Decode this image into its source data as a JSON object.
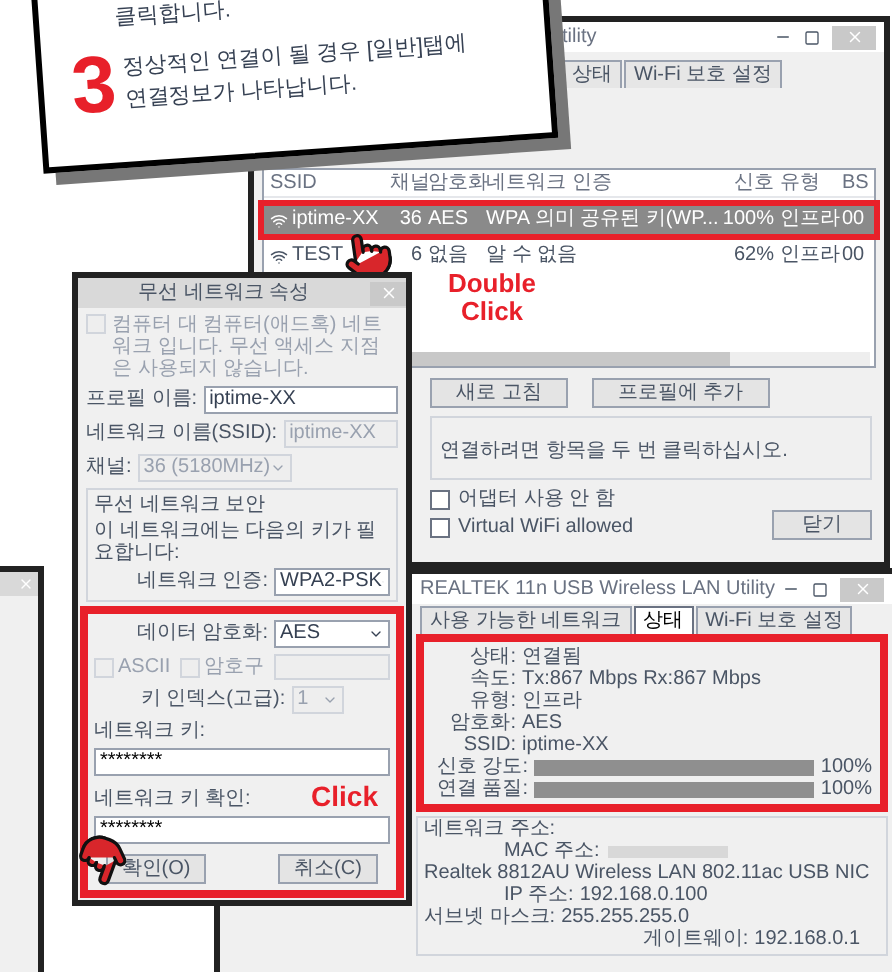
{
  "callout": {
    "previous_line": "클릭합니다.",
    "step_number": "3",
    "text": "정상적인 연결이 될 경우 [일반]탭에 연결정보가 나타납니다."
  },
  "networks_window": {
    "title": "tility",
    "tabs": [
      {
        "label": "상태",
        "selected": false
      },
      {
        "label": "Wi-Fi 보호 설정",
        "selected": false
      }
    ],
    "columns": [
      "SSID",
      "채널",
      "암호화",
      "네트워크 인증",
      "신호",
      "유형",
      "BS"
    ],
    "rows": [
      {
        "ssid": "iptime-XX",
        "channel": "36",
        "encryption": "AES",
        "auth": "WPA 의미 공유된 키(WP...",
        "signal": "100%",
        "type": "인프라",
        "bssid": "00",
        "selected": true
      },
      {
        "ssid": "TEST",
        "channel": "6",
        "encryption": "없음",
        "auth": "알 수 없음",
        "signal": "62%",
        "type": "인프라",
        "bssid": "00",
        "selected": false
      }
    ],
    "gesture_label": "Double Click",
    "buttons": [
      "새로 고침",
      "프로필에 추가"
    ],
    "hint": "연결하려면 항목을 두 번 클릭하십시오.",
    "options": [
      {
        "label": "어댑터 사용 안 함",
        "checked": false
      },
      {
        "label": "Virtual WiFi allowed",
        "checked": false
      }
    ],
    "close_button": "닫기"
  },
  "properties_dialog": {
    "title": "무선 네트워크 속성",
    "adhoc": {
      "label": "컴퓨터 대 컴퓨터(애드혹) 네트워크 입니다. 무선 액세스 지점은 사용되지 않습니다.",
      "checked": false,
      "disabled": true
    },
    "fields": [
      {
        "kind": "input",
        "label": "프로필 이름:",
        "value": "iptime-XX",
        "disabled": false
      },
      {
        "kind": "input",
        "label": "네트워크 이름(SSID):",
        "value": "iptime-XX",
        "disabled": true
      },
      {
        "kind": "select",
        "label": "채널:",
        "value": "36 (5180MHz)",
        "disabled": true
      }
    ],
    "security_group": "무선 네트워크 보안",
    "security_note": "이 네트워크에는 다음의 키가 필요합니다:",
    "auth": {
      "label": "네트워크 인증:",
      "value": "WPA2-PSK"
    },
    "encryption": {
      "label": "데이터 암호화:",
      "value": "AES"
    },
    "key_options": [
      {
        "label": "ASCII",
        "checked": false
      },
      {
        "label": "암호구",
        "checked": false
      }
    ],
    "key_index": {
      "label": "키 인덱스(고급):",
      "value": "1"
    },
    "key": {
      "label": "네트워크 키:",
      "value": "********"
    },
    "key_confirm": {
      "label": "네트워크 키 확인:",
      "value": "********"
    },
    "gesture_label": "Click",
    "buttons": [
      "확인(O)",
      "취소(C)"
    ]
  },
  "utility_window": {
    "title": "REALTEK 11n USB Wireless LAN Utility",
    "tabs": [
      {
        "label": "사용 가능한 네트워크",
        "selected": false
      },
      {
        "label": "상태",
        "selected": true
      },
      {
        "label": "Wi-Fi 보호 설정",
        "selected": false
      }
    ],
    "status": [
      {
        "label": "상태:",
        "value": "연결됨"
      },
      {
        "label": "속도:",
        "value": "Tx:867 Mbps Rx:867 Mbps"
      },
      {
        "label": "유형:",
        "value": "인프라"
      },
      {
        "label": "암호화:",
        "value": "AES"
      },
      {
        "label": "SSID:",
        "value": "iptime-XX"
      }
    ],
    "meters": [
      {
        "label": "신호 강도:",
        "level": 1.0,
        "reading": "100%"
      },
      {
        "label": "연결 품질:",
        "level": 1.0,
        "reading": "100%"
      }
    ],
    "address_group": "네트워크 주소:",
    "mac_label": "MAC 주소:",
    "adapter": "Realtek 8812AU Wireless LAN 802.11ac USB NIC",
    "ip": {
      "label": "IP 주소:",
      "value": "192.168.0.100"
    },
    "subnet": {
      "label": "서브넷 마스크:",
      "value": "255.255.255.0"
    },
    "gateway": {
      "label": "게이트웨이:",
      "value": "192.168.0.1"
    }
  }
}
